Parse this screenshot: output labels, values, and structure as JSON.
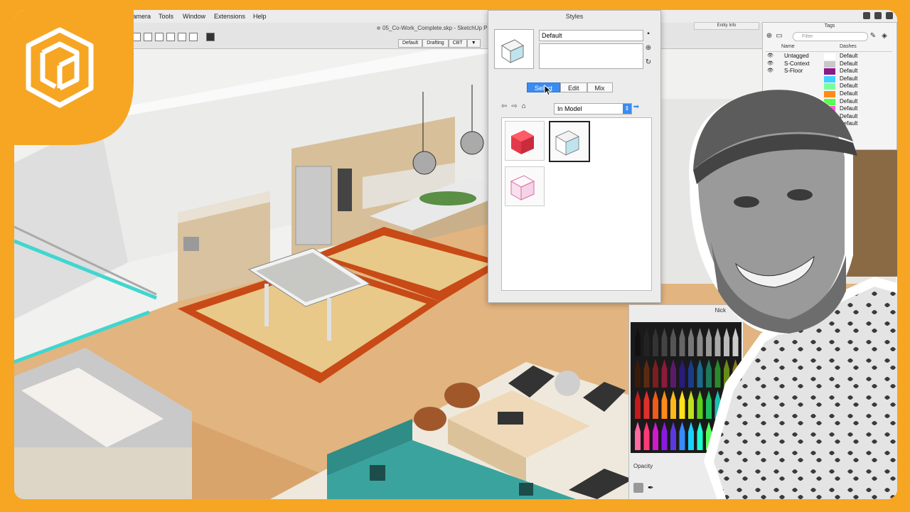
{
  "window": {
    "title": "05_Co-Work_Complete.skp - SketchUp P"
  },
  "menu": [
    "Camera",
    "Tools",
    "Window",
    "Extensions",
    "Help"
  ],
  "scene_tabs": [
    "Default",
    "Drafting",
    "CBT"
  ],
  "scene_tabs_more": "▼",
  "styles_panel": {
    "title": "Styles",
    "style_name": "Default",
    "tabs": [
      "Select",
      "Edit",
      "Mix"
    ],
    "active_tab": "Select",
    "collection": "In Model"
  },
  "entity_info": {
    "title": "Entity Info"
  },
  "tags_panel": {
    "title": "Tags",
    "filter_placeholder": "Filter",
    "col_name": "Name",
    "col_dashes": "Dashes",
    "rows": [
      {
        "name": "Untagged",
        "dashes": "Default",
        "color": "#ffffff"
      },
      {
        "name": "S-Context",
        "dashes": "Default",
        "color": "#c8c8c8"
      },
      {
        "name": "S-Floor",
        "dashes": "Default",
        "color": "#8a1a8a"
      },
      {
        "name": "",
        "dashes": "Default",
        "color": "#3fd3ff"
      },
      {
        "name": "",
        "dashes": "Default",
        "color": "#7aff9b"
      },
      {
        "name": "",
        "dashes": "Default",
        "color": "#ff8a1a"
      },
      {
        "name": "",
        "dashes": "Default",
        "color": "#58ff4a"
      },
      {
        "name": "",
        "dashes": "Default",
        "color": "#ff5ad4"
      },
      {
        "name": "",
        "dashes": "Default",
        "color": "#8c7cff"
      },
      {
        "name": "",
        "dashes": "Default",
        "color": "#cfe0ff"
      }
    ]
  },
  "colors_panel": {
    "title": "Nick",
    "opacity_label": "Opacity"
  },
  "colors": {
    "accent": "#f6a623",
    "select_blue": "#3b8cf1"
  }
}
